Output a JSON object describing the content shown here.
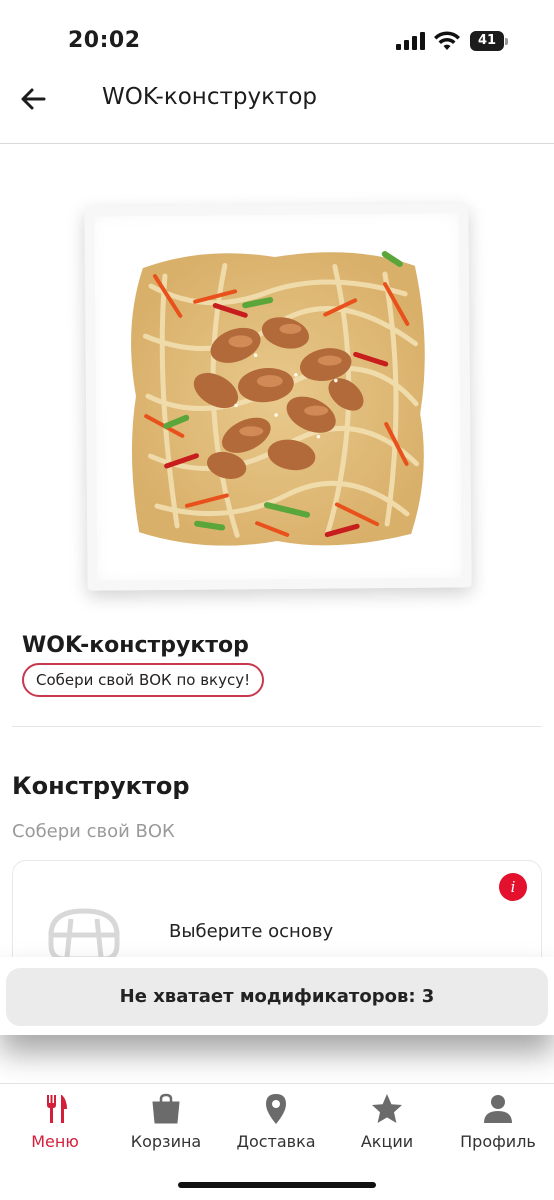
{
  "status_bar": {
    "time": "20:02",
    "battery": "41"
  },
  "header": {
    "title": "WOK-конструктор"
  },
  "product": {
    "name": "WOK-конструктор",
    "tag": "Собери свой ВОК по вкусу!"
  },
  "constructor": {
    "title": "Конструктор",
    "subtitle": "Собери свой ВОК",
    "modifier_card": {
      "label": "Выберите основу",
      "info_icon": "i"
    }
  },
  "warning": {
    "text": "Не хватает модификаторов: 3"
  },
  "tabbar": {
    "active_color": "#d41f3b",
    "items": [
      {
        "label": "Меню",
        "icon": "fork-knife-icon"
      },
      {
        "label": "Корзина",
        "icon": "bag-icon"
      },
      {
        "label": "Доставка",
        "icon": "map-pin-icon"
      },
      {
        "label": "Акции",
        "icon": "star-icon"
      },
      {
        "label": "Профиль",
        "icon": "person-icon"
      }
    ]
  }
}
